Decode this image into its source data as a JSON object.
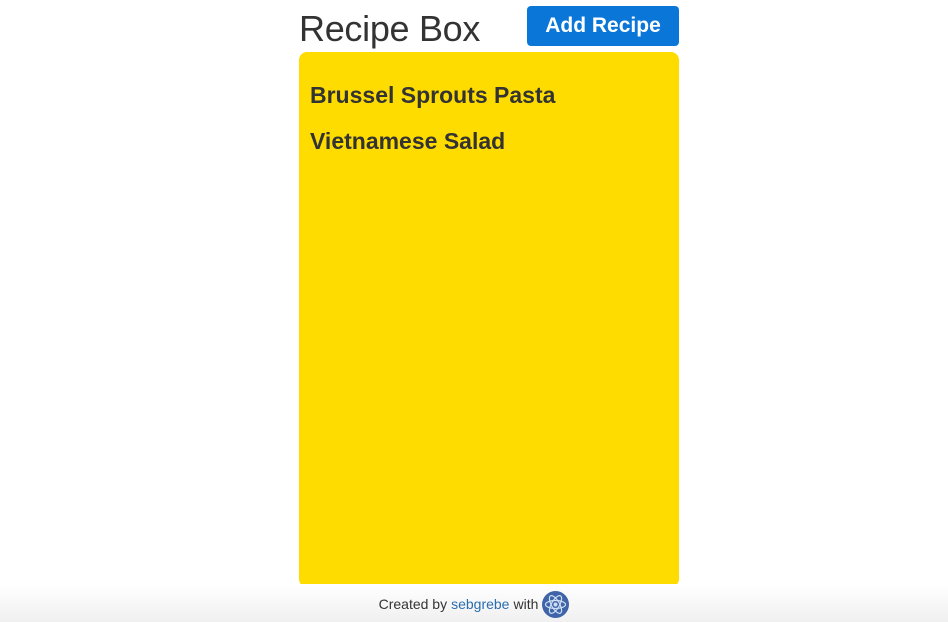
{
  "header": {
    "title": "Recipe Box",
    "add_button_label": "Add Recipe"
  },
  "recipes": [
    {
      "name": "Brussel Sprouts Pasta"
    },
    {
      "name": "Vietnamese Salad"
    }
  ],
  "footer": {
    "created_by_text": "Created by",
    "author_link": "sebgrebe",
    "with_text": "with",
    "icon": "react-logo-icon"
  },
  "colors": {
    "card_background": "#ffdc00",
    "button_background": "#0a77d8",
    "link": "#2a6db0",
    "text": "#333333"
  }
}
